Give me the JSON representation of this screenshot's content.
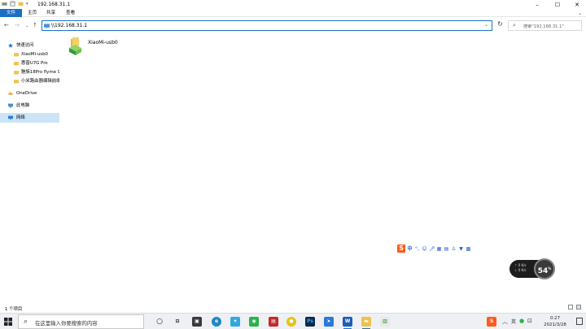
{
  "window": {
    "title": "192.168.31.1",
    "controls": {
      "minimize": "–",
      "maximize": "☐",
      "close": "✕"
    }
  },
  "ribbon": {
    "tabs": [
      "文件",
      "主页",
      "共享",
      "查看"
    ]
  },
  "address_bar": {
    "path": "\\\\192.168.31.1",
    "search_placeholder": "搜索\"192.168.31.1\""
  },
  "nav_pane": {
    "items": [
      {
        "label": "快速访问",
        "icon": "star-icon"
      },
      {
        "label": "XiaoMi-usb0",
        "icon": "folder-icon"
      },
      {
        "label": "惠普U7G Pro",
        "icon": "folder-icon"
      },
      {
        "label": "魅族18Pro flyme 9",
        "icon": "folder-icon"
      },
      {
        "label": "小米路由器编辑前端",
        "icon": "folder-icon"
      },
      {
        "label": "OneDrive",
        "icon": "cloud-icon"
      },
      {
        "label": "此电脑",
        "icon": "computer-icon"
      },
      {
        "label": "网络",
        "icon": "network-icon",
        "selected": true
      }
    ]
  },
  "content": {
    "items": [
      {
        "name": "XiaoMi-usb0",
        "icon": "shared-folder-icon"
      }
    ]
  },
  "status_bar": {
    "item_count": "1 个项目"
  },
  "ime_toolbar": {
    "brand": "S",
    "mode": "中"
  },
  "speed_widget": {
    "upload": "0 K/s",
    "download": "0 K/s",
    "value": "54",
    "unit": "%"
  },
  "taskbar": {
    "search_placeholder": "在这里输入你要搜索的内容",
    "time": "0:27",
    "date": "2021/3/28",
    "tray_ime": "英"
  }
}
